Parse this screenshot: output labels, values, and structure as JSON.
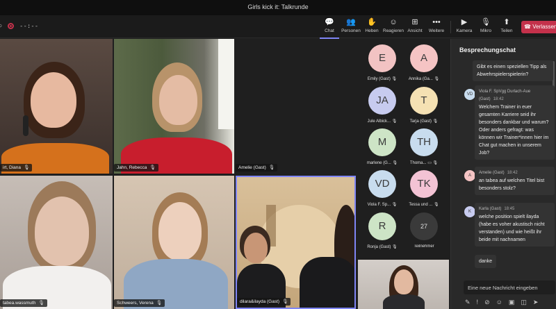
{
  "window": {
    "title": "Girls kick it: Talkrunde",
    "timer": "--:--"
  },
  "toolbar": {
    "chat": "Chat",
    "people": "Personen",
    "raise": "Heben",
    "react": "Reagieren",
    "view": "Ansicht",
    "more": "Weitere",
    "camera": "Kamera",
    "mic": "Mikro",
    "share": "Teilen",
    "leave": "Verlassen"
  },
  "videos": [
    {
      "name": "irt, Diana"
    },
    {
      "name": "Jahn, Rebecca"
    },
    {
      "name": "Amelie (Gast)"
    },
    {
      "name": "tabea.wassmuth"
    },
    {
      "name": "Schweers, Verena"
    },
    {
      "name": "dilara&ilayda (Gast)"
    }
  ],
  "participants": [
    {
      "initials": "E",
      "label": "Emily (Gast)",
      "color": "#f2c3c3"
    },
    {
      "initials": "A",
      "label": "Annika (Ga...",
      "color": "#f5c4c4"
    },
    {
      "initials": "JA",
      "label": "Jule Albick...",
      "color": "#c7cbef"
    },
    {
      "initials": "T",
      "label": "Tarja (Gast)",
      "color": "#f5e1b3"
    },
    {
      "initials": "M",
      "label": "marlene (G...",
      "color": "#cde4c6"
    },
    {
      "initials": "TH",
      "label": "Thoma...",
      "color": "#c8dcee"
    },
    {
      "initials": "VD",
      "label": "Viola F. Sp...",
      "color": "#c8dcee"
    },
    {
      "initials": "TK",
      "label": "Tessa und ...",
      "color": "#f3c3d4"
    },
    {
      "initials": "R",
      "label": "Ronja (Gast)",
      "color": "#cde4c6"
    },
    {
      "initials": "27",
      "label": "Teilnehmer",
      "color": "#3a3a3a"
    }
  ],
  "chat": {
    "header": "Besprechungschat",
    "messages": [
      {
        "text": "Gibt es einen speziellen Tipp als Abwehrspielerspielerin?"
      },
      {
        "initials": "VD",
        "author": "Viola F. SpVgg Durlach-Aue (Gast)",
        "time": "18:42",
        "text": "Welchem Trainer in euer gesamten Karriere seid ihr besonders dankbar und warum? Oder anders gefragt: was können wir Trainer*innen hier im Chat gut machen in unserem Job?"
      },
      {
        "initials": "A",
        "author": "Amelie (Gast)",
        "time": "18:42",
        "text": "an tabea auf welchen Titel bist besonders stolz?"
      },
      {
        "initials": "K",
        "author": "Karla (Gast)",
        "time": "18:45",
        "text": "welche position spielt ilayda (habe es voher akustisch nicht verstanden) und wie heißt ihr beide mit nachnamen"
      },
      {
        "text": "danke"
      }
    ],
    "input_placeholder": "Eine neue Nachricht eingeben"
  }
}
